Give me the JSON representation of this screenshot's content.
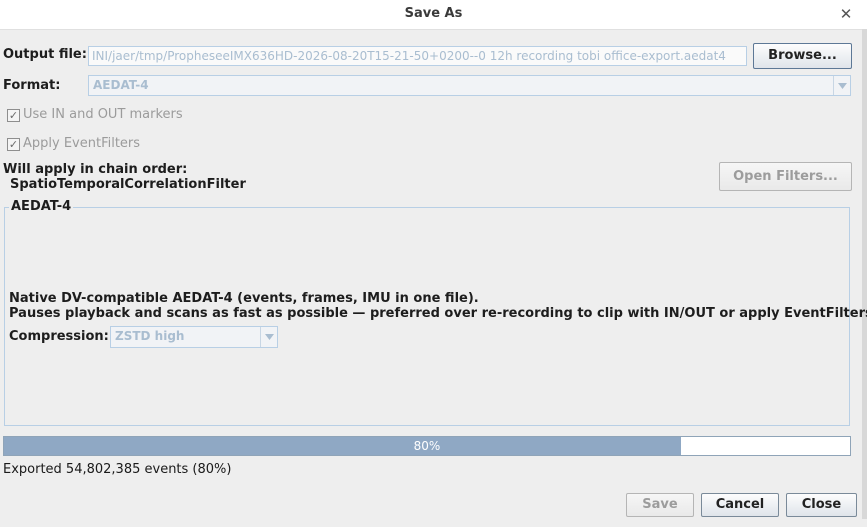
{
  "window": {
    "title": "Save As"
  },
  "output": {
    "label": "Output file:",
    "value": "INI/jaer/tmp/PropheseeIMX636HD-2026-08-20T15-21-50+0200--0 12h recording tobi office-export.aedat4",
    "browse_label": "Browse..."
  },
  "format": {
    "label": "Format:",
    "selected": "AEDAT-4"
  },
  "options": {
    "use_markers_label": "Use IN and OUT markers",
    "use_markers_checked": true,
    "apply_filters_label": "Apply EventFilters",
    "apply_filters_checked": true
  },
  "chain": {
    "heading": "Will apply in chain order:",
    "filters": "SpatioTemporalCorrelationFilter",
    "open_filters_label": "Open Filters..."
  },
  "group": {
    "title": "AEDAT-4",
    "desc_line1": "Native DV-compatible AEDAT-4 (events, frames, IMU in one file).",
    "desc_line2": "Pauses playback and scans as fast as possible — preferred over re-recording to clip with IN/OUT or apply EventFilters.",
    "compression_label": "Compression:",
    "compression_value": "ZSTD high"
  },
  "progress": {
    "fraction": 0.8,
    "text": "80%"
  },
  "status": {
    "text": "Exported 54,802,385 events (80%)"
  },
  "buttons": {
    "save": "Save",
    "cancel": "Cancel",
    "close": "Close"
  },
  "colors": {
    "accent_border": "#b8cfe5",
    "progress_fill": "#8fa8c4"
  }
}
